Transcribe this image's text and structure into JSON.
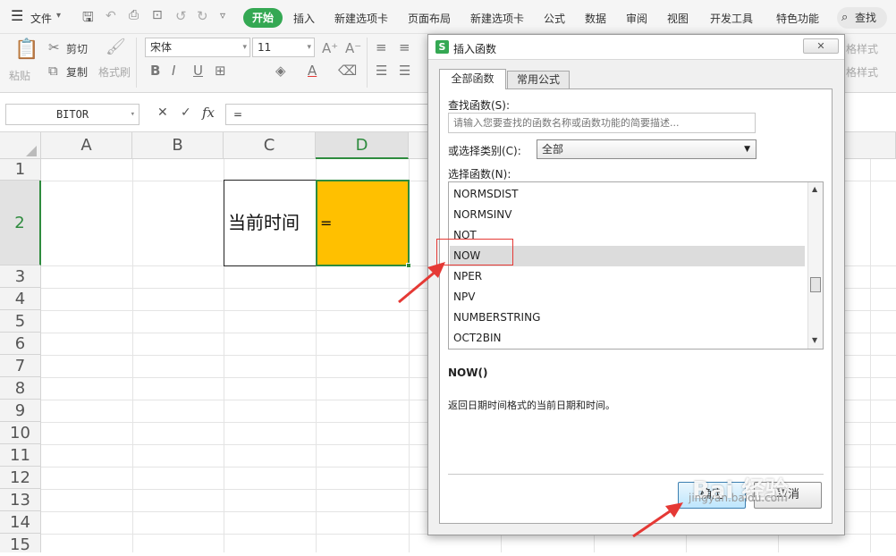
{
  "menubar": {
    "file_label": "文件",
    "items": [
      "开始",
      "插入",
      "新建选项卡",
      "页面布局",
      "新建选项卡",
      "公式",
      "数据",
      "审阅",
      "视图",
      "开发工具",
      "特色功能"
    ],
    "search_label": "查找"
  },
  "ribbon": {
    "paste": "粘贴",
    "cut": "剪切",
    "copy": "复制",
    "format_painter": "格式刷",
    "font_name": "宋体",
    "font_size": "11",
    "right_partial_1": "格样式",
    "right_partial_2": "格样式"
  },
  "formula_bar": {
    "name_box": "BITOR",
    "fx": "fx",
    "cancel_icon": "✕",
    "confirm_icon": "✓",
    "content": "="
  },
  "sheet": {
    "columns": [
      "A",
      "B",
      "C",
      "D"
    ],
    "rows": [
      "1",
      "2",
      "3",
      "4",
      "5",
      "6",
      "7",
      "8",
      "9",
      "10",
      "11",
      "12",
      "13",
      "14",
      "15"
    ],
    "cell_c2": "当前时间",
    "cell_d2": "=",
    "highlight_color": "#ffc000",
    "active_header_color": "#2e8b3e"
  },
  "dialog": {
    "title": "插入函数",
    "tabs": [
      "全部函数",
      "常用公式"
    ],
    "search_label": "查找函数(S):",
    "search_placeholder": "请输入您要查找的函数名称或函数功能的简要描述...",
    "category_label": "或选择类别(C):",
    "category_value": "全部",
    "list_label": "选择函数(N):",
    "functions": [
      "NORMSDIST",
      "NORMSINV",
      "NOT",
      "NOW",
      "NPER",
      "NPV",
      "NUMBERSTRING",
      "OCT2BIN"
    ],
    "selected_function": "NOW",
    "signature": "NOW()",
    "description": "返回日期时间格式的当前日期和时间。",
    "ok_label": "确定",
    "cancel_label": "取消"
  },
  "watermark": {
    "text": "Bai 经验",
    "url": "jingyan.baidu.com"
  },
  "colors": {
    "accent": "#34a853",
    "annotation": "#e53935",
    "selection": "#dcdcdc"
  }
}
